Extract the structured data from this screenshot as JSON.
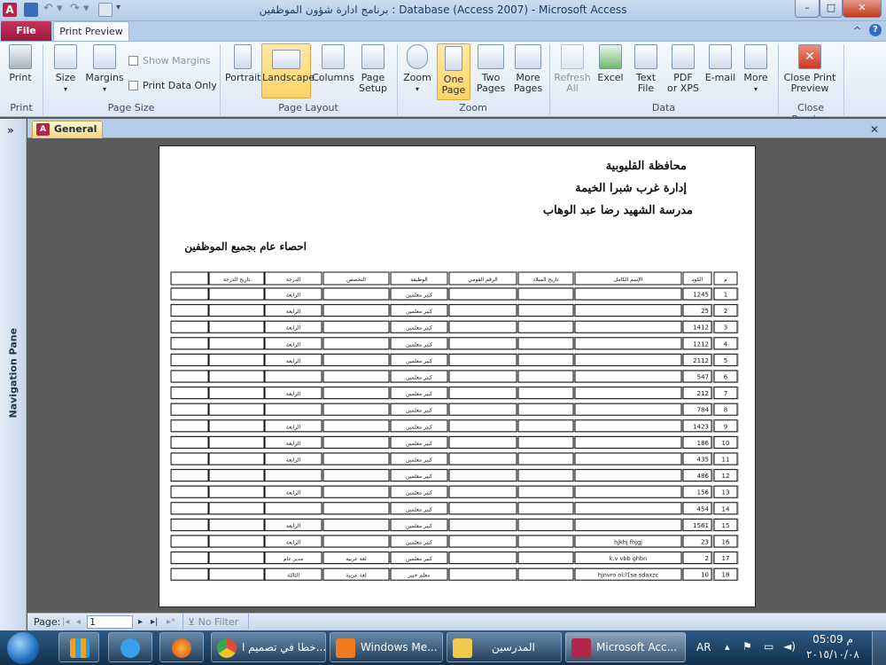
{
  "window": {
    "title": "برنامج ادارة شؤون الموظفين : Database (Access 2007)  -  Microsoft Access",
    "minimize": "–",
    "maximize": "□",
    "close": "✕",
    "help": "?",
    "collapse": "^"
  },
  "tabs": {
    "file": "File",
    "print_preview": "Print Preview"
  },
  "ribbon": {
    "print": {
      "label": "Print",
      "group": "Print"
    },
    "page_size": {
      "size": "Size",
      "margins": "Margins",
      "show_margins": "Show Margins",
      "print_data_only": "Print Data Only",
      "group": "Page Size"
    },
    "page_layout": {
      "portrait": "Portrait",
      "landscape": "Landscape",
      "columns": "Columns",
      "page_setup_1": "Page",
      "page_setup_2": "Setup",
      "group": "Page Layout"
    },
    "zoom": {
      "zoom": "Zoom",
      "one_page_1": "One",
      "one_page_2": "Page",
      "two_pages_1": "Two",
      "two_pages_2": "Pages",
      "more_pages_1": "More",
      "more_pages_2": "Pages",
      "group": "Zoom"
    },
    "data": {
      "refresh_1": "Refresh",
      "refresh_2": "All",
      "excel": "Excel",
      "text_1": "Text",
      "text_2": "File",
      "pdf_1": "PDF",
      "pdf_2": "or XPS",
      "email": "E-mail",
      "more": "More",
      "group": "Data"
    },
    "close_preview": {
      "label_1": "Close Print",
      "label_2": "Preview",
      "group": "Close Preview"
    }
  },
  "nav": {
    "label": "Navigation Pane",
    "toggle": "»"
  },
  "document": {
    "tab": "General",
    "close": "✕"
  },
  "report": {
    "header_line1": "محافظة القليوبية",
    "header_line2": "إدارة غرب شبرا الخيمة",
    "header_line3": "مدرسة الشهيد رضا عبد الوهاب",
    "title": "احصاء عام بجميع الموظفين",
    "columns": [
      "م",
      "الكود",
      "الإسم الكامل",
      "تاريخ الميلاد",
      "الرقم القومي",
      "الوظيفة",
      "التخصص",
      "الدرجة",
      "تاريخ الدرجة"
    ],
    "rows": [
      {
        "n": "1",
        "code": "1245",
        "name": "",
        "job": "كبير معلمين",
        "spec": "",
        "grade": "الرابعة"
      },
      {
        "n": "2",
        "code": "25",
        "name": "",
        "job": "كبير معلمين",
        "spec": "",
        "grade": "الرابعة"
      },
      {
        "n": "3",
        "code": "1412",
        "name": "",
        "job": "كبير معلمين",
        "spec": "",
        "grade": "الرابعة"
      },
      {
        "n": "4",
        "code": "1212",
        "name": "",
        "job": "كبير معلمين",
        "spec": "",
        "grade": "الرابعة"
      },
      {
        "n": "5",
        "code": "2112",
        "name": "",
        "job": "كبير معلمين",
        "spec": "",
        "grade": "الرابعة"
      },
      {
        "n": "6",
        "code": "547",
        "name": "",
        "job": "كبير معلمين",
        "spec": "",
        "grade": ""
      },
      {
        "n": "7",
        "code": "212",
        "name": "",
        "job": "كبير معلمين",
        "spec": "",
        "grade": "الرابعة"
      },
      {
        "n": "8",
        "code": "784",
        "name": "",
        "job": "كبير معلمين",
        "spec": "",
        "grade": ""
      },
      {
        "n": "9",
        "code": "1423",
        "name": "",
        "job": "كبير معلمين",
        "spec": "",
        "grade": "الرابعة"
      },
      {
        "n": "10",
        "code": "186",
        "name": "",
        "job": "كبير معلمين",
        "spec": "",
        "grade": "الرابعة"
      },
      {
        "n": "11",
        "code": "435",
        "name": "",
        "job": "كبير معلمين",
        "spec": "",
        "grade": "الرابعة"
      },
      {
        "n": "12",
        "code": "486",
        "name": "",
        "job": "كبير معلمين",
        "spec": "",
        "grade": ""
      },
      {
        "n": "13",
        "code": "156",
        "name": "",
        "job": "كبير معلمين",
        "spec": "",
        "grade": "الرابعة"
      },
      {
        "n": "14",
        "code": "454",
        "name": "",
        "job": "كبير معلمين",
        "spec": "",
        "grade": ""
      },
      {
        "n": "15",
        "code": "1561",
        "name": "",
        "job": "كبير معلمين",
        "spec": "",
        "grade": "الرابعة"
      },
      {
        "n": "16",
        "code": "23",
        "name": "hjkhj fhjgj",
        "job": "كبير معلمين",
        "spec": "",
        "grade": "الرابعة"
      },
      {
        "n": "17",
        "code": "2",
        "name": "k,v vbb ghbn",
        "job": "كبير معلمين",
        "spec": "لغة عربية",
        "grade": "مدير عام"
      },
      {
        "n": "18",
        "code": "10",
        "name": "hjnvro ol;l'[sa sdaxzc",
        "job": "معلم خبير",
        "spec": "لغة عربية",
        "grade": "الثالثة"
      }
    ]
  },
  "status": {
    "page_label": "Page:",
    "page_value": "1",
    "filter": "No Filter"
  },
  "taskbar": {
    "items": [
      "خطا في تصميم ا...",
      "Windows Me...",
      "المدرسين",
      "Microsoft Acc..."
    ],
    "lang": "AR",
    "time": "05:09 م",
    "date": "٢٠١٥/١٠/٠٨"
  },
  "colors": {
    "ribbon_selected": "#ffd466",
    "file_tab": "#b3254b",
    "taskbar": "#1f4466"
  }
}
